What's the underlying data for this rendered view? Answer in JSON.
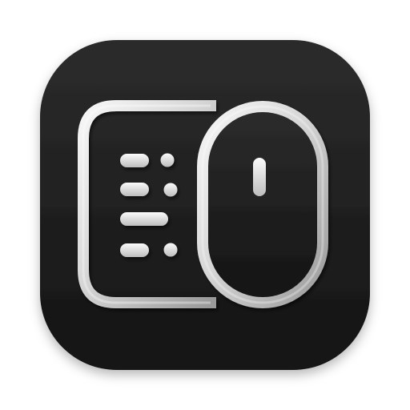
{
  "app_icon": {
    "name": "keyboard-and-mouse-app-icon",
    "icon_symbols": [
      "keyboard-icon",
      "mouse-icon"
    ],
    "colors": {
      "tile_top": "#2c2c2c",
      "tile_bottom": "#141414",
      "glyph_light": "#f4f4f4",
      "glyph_mid": "#cfcfcf",
      "glyph_dark": "#8e8e8e"
    }
  }
}
